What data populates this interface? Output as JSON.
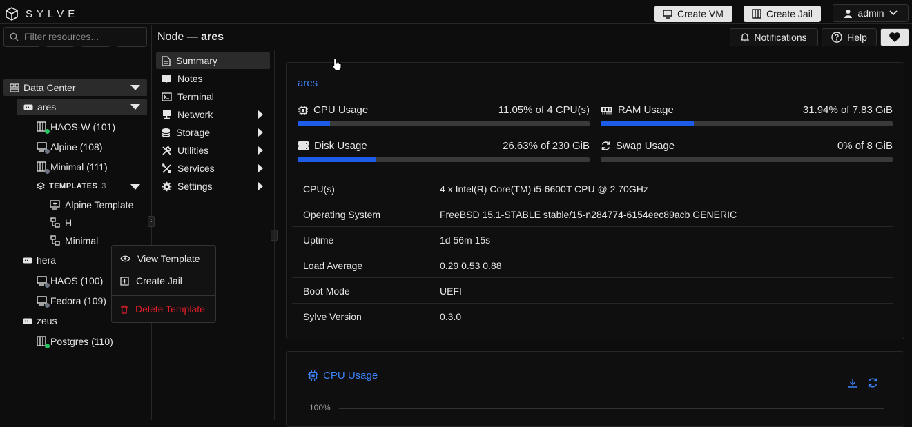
{
  "app": {
    "name": "SYLVE"
  },
  "header": {
    "create_vm": "Create VM",
    "create_jail": "Create Jail",
    "user": "admin",
    "notifications": "Notifications",
    "help": "Help"
  },
  "page": {
    "title_prefix": "Node —",
    "title_node": "ares"
  },
  "filter": {
    "placeholder": "Filter resources..."
  },
  "tree": {
    "datacenter": "Data Center",
    "nodes": [
      {
        "name": "ares",
        "items": [
          {
            "label": "HAOS-W (101)",
            "status": "running"
          },
          {
            "label": "Alpine (108)",
            "status": "stopped"
          },
          {
            "label": "Minimal (111)",
            "status": "stopped"
          }
        ]
      },
      {
        "name": "hera",
        "items": [
          {
            "label": "HAOS (100)",
            "status": "stopped"
          },
          {
            "label": "Fedora (109)",
            "status": "stopped"
          }
        ]
      },
      {
        "name": "zeus",
        "items": [
          {
            "label": "Postgres (110)",
            "status": "running"
          }
        ]
      }
    ],
    "templates": {
      "label": "TEMPLATES",
      "count": "3",
      "items": [
        "Alpine Template",
        "H",
        "Minimal"
      ]
    }
  },
  "context_menu": {
    "view": "View Template",
    "create_jail": "Create Jail",
    "delete": "Delete Template"
  },
  "nav": {
    "summary": "Summary",
    "notes": "Notes",
    "terminal": "Terminal",
    "network": "Network",
    "storage": "Storage",
    "utilities": "Utilities",
    "services": "Services",
    "settings": "Settings"
  },
  "summary": {
    "node_name": "ares",
    "cpu": {
      "label": "CPU Usage",
      "value": "11.05% of 4 CPU(s)",
      "percent": 11.05
    },
    "ram": {
      "label": "RAM Usage",
      "value": "31.94% of 7.83 GiB",
      "percent": 31.94
    },
    "disk": {
      "label": "Disk Usage",
      "value": "26.63% of 230 GiB",
      "percent": 26.63
    },
    "swap": {
      "label": "Swap Usage",
      "value": "0% of 8 GiB",
      "percent": 0
    },
    "info": [
      {
        "key": "CPU(s)",
        "value": "4 x Intel(R) Core(TM) i5-6600T CPU @ 2.70GHz"
      },
      {
        "key": "Operating System",
        "value": "FreeBSD 15.1-STABLE stable/15-n284774-6154eec89acb GENERIC"
      },
      {
        "key": "Uptime",
        "value": "1d 56m 15s"
      },
      {
        "key": "Load Average",
        "value": "0.29 0.53 0.88"
      },
      {
        "key": "Boot Mode",
        "value": "UEFI"
      },
      {
        "key": "Sylve Version",
        "value": "0.3.0"
      }
    ]
  },
  "cpu_chart": {
    "title": "CPU Usage",
    "ytick": "100%"
  },
  "colors": {
    "accent": "#3b82f6",
    "running": "#22c55e",
    "stopped": "#6b7280",
    "danger": "#e11d2a",
    "bar": "#1d5ce8"
  }
}
